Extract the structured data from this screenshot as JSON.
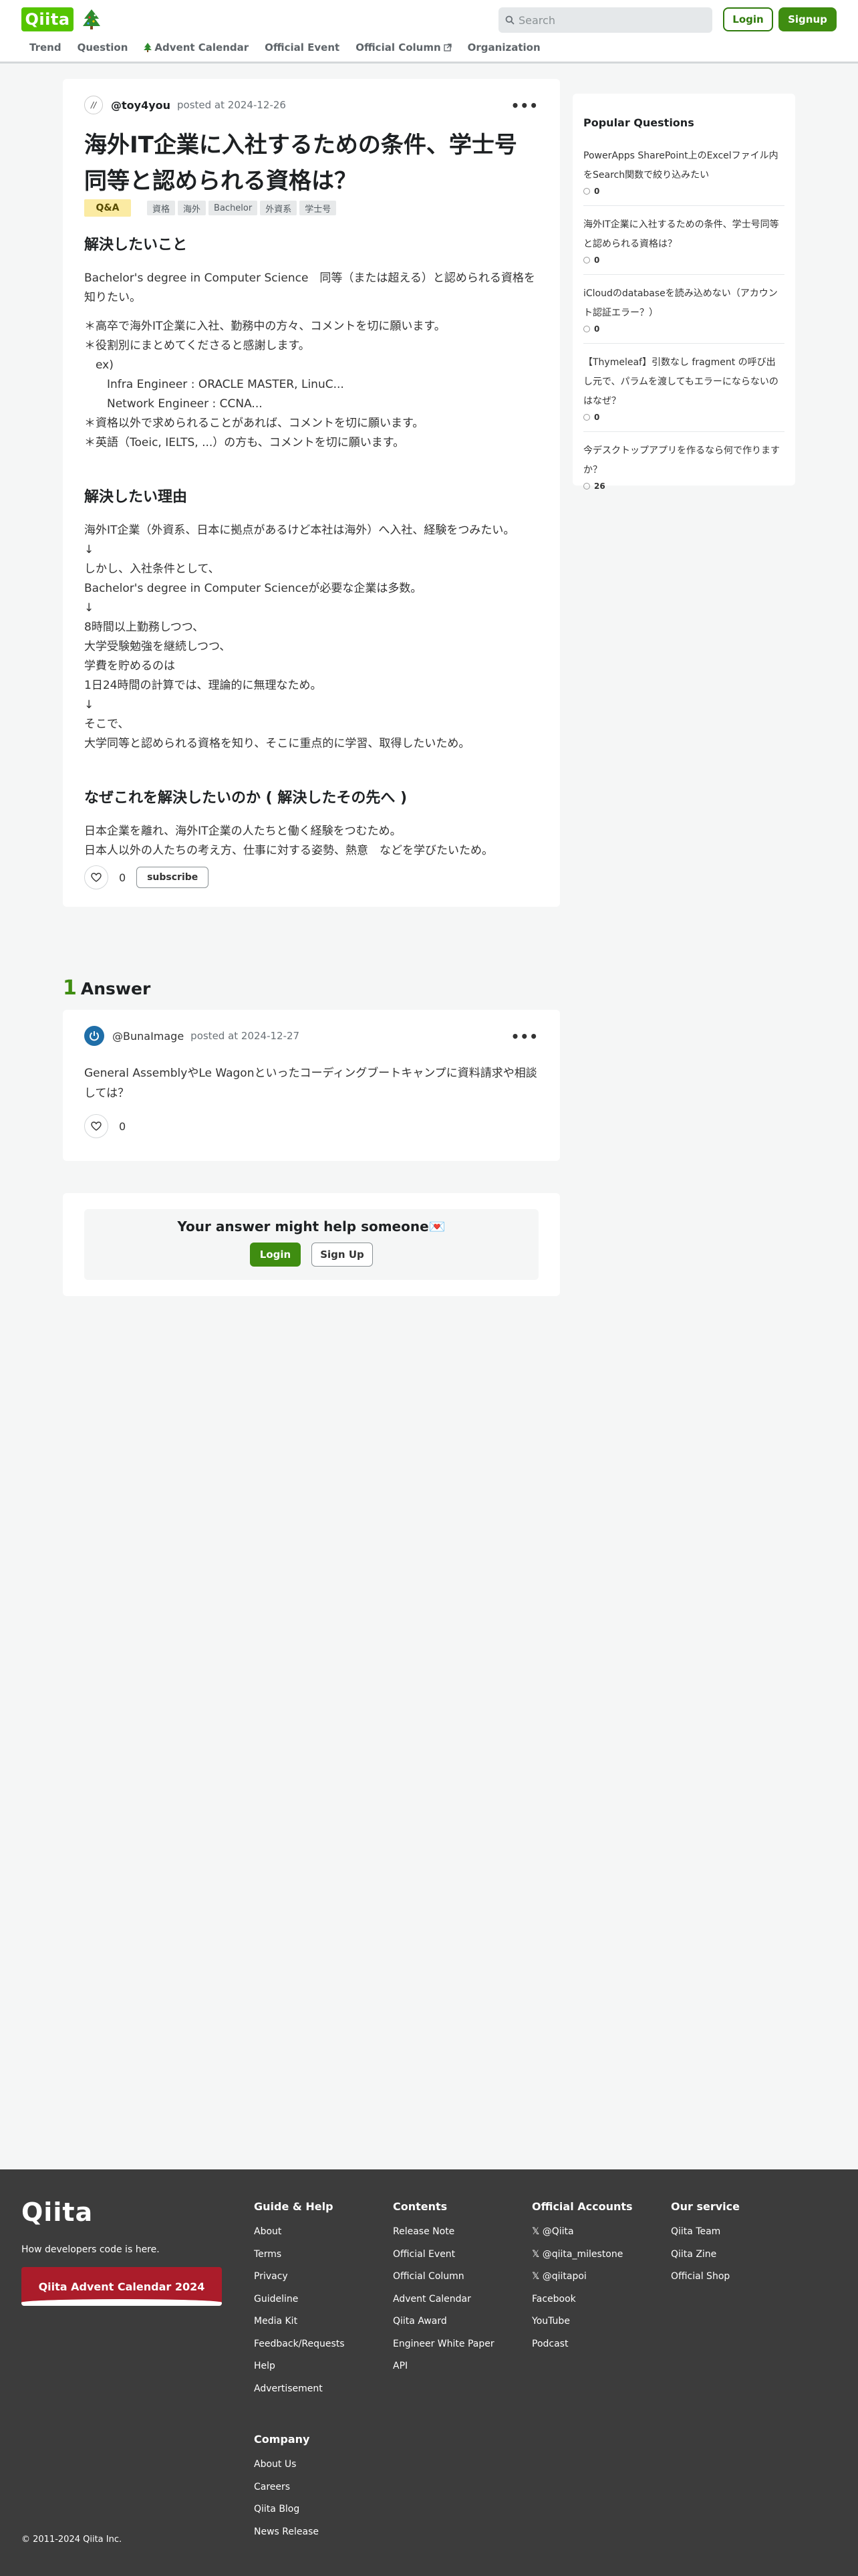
{
  "header": {
    "logo": "Qiita",
    "search_placeholder": "Search",
    "login_label": "Login",
    "signup_label": "Signup",
    "nav": [
      "Trend",
      "Question",
      "Advent Calendar",
      "Official Event",
      "Official Column",
      "Organization"
    ]
  },
  "question": {
    "author": "@toy4you",
    "posted": "posted at 2024-12-26",
    "title": "海外IT企業に入社するための条件、学士号同等と認められる資格は？",
    "badge": "Q&A",
    "tags": [
      "資格",
      "海外",
      "Bachelor",
      "外資系",
      "学士号"
    ],
    "sections": [
      {
        "heading": "解決したいこと",
        "paragraphs": [
          [
            "Bachelor's degree in Computer Science　同等（または超える）と認められる資格を知りたい。"
          ],
          [
            "＊高卒で海外IT企業に入社、勤務中の方々、コメントを切に願います。",
            "＊役割別にまとめてくださると感謝します。",
            "　ex)",
            "　　Infra Engineer : ORACLE MASTER, LinuC...",
            "　　Network Engineer : CCNA...",
            "＊資格以外で求められることがあれば、コメントを切に願います。",
            "＊英語（Toeic, IELTS, ...）の方も、コメントを切に願います。"
          ]
        ]
      },
      {
        "heading": "解決したい理由",
        "paragraphs": [
          [
            "海外IT企業（外資系、日本に拠点があるけど本社は海外）へ入社、経験をつみたい。",
            "↓",
            "しかし、入社条件として、",
            "Bachelor's degree in Computer Scienceが必要な企業は多数。",
            "↓",
            "8時間以上勤務しつつ、",
            "大学受験勉強を継続しつつ、",
            "学費を貯めるのは",
            "1日24時間の計算では、理論的に無理なため。",
            "↓",
            "そこで、",
            "大学同等と認められる資格を知り、そこに重点的に学習、取得したいため。"
          ]
        ]
      },
      {
        "heading": "なぜこれを解決したいのか ( 解決したその先へ )",
        "paragraphs": [
          [
            "日本企業を離れ、海外IT企業の人たちと働く経験をつむため。",
            "日本人以外の人たちの考え方、仕事に対する姿勢、熱意　などを学びたいため。"
          ]
        ]
      }
    ],
    "likes": "0",
    "subscribe_label": "subscribe"
  },
  "sidebar": {
    "title": "Popular Questions",
    "items": [
      {
        "question": "PowerApps SharePoint上のExcelファイル内をSearch関数で絞り込みたい",
        "comments": "0"
      },
      {
        "question": "海外IT企業に入社するための条件、学士号同等と認められる資格は？",
        "comments": "0"
      },
      {
        "question": "iCloudのdatabaseを読み込めない（アカウント認証エラー？）",
        "comments": "0"
      },
      {
        "question": "【Thymeleaf】引数なし fragment の呼び出し元で、パラムを渡してもエラーにならないのはなぜ？",
        "comments": "0"
      },
      {
        "question": "今デスクトップアプリを作るなら何で作りますか？",
        "comments": "26"
      }
    ]
  },
  "answers": {
    "count": "1",
    "label": "Answer",
    "items": [
      {
        "author": "@BunaImage",
        "posted": "posted at 2024-12-27",
        "body": "General AssemblyやLe Wagonといったコーディングブートキャンプに資料請求や相談しては？",
        "likes": "0"
      }
    ]
  },
  "cta": {
    "title": "Your answer might help someone💌",
    "login_label": "Login",
    "signup_label": "Sign Up"
  },
  "footer": {
    "logo": "Qiita",
    "tagline": "How developers code is here.",
    "banner": "Qiita Advent Calendar 2024",
    "columns": [
      {
        "title": "Guide & Help",
        "links": [
          "About",
          "Terms",
          "Privacy",
          "Guideline",
          "Media Kit",
          "Feedback/Requests",
          "Help",
          "Advertisement"
        ]
      },
      {
        "title": "Contents",
        "links": [
          "Release Note",
          "Official Event",
          "Official Column",
          "Advent Calendar",
          "Qiita Award",
          "Engineer White Paper",
          "API"
        ]
      },
      {
        "title": "Official Accounts",
        "links": [
          "@Qiita",
          "@qiita_milestone",
          "@qiitapoi",
          "Facebook",
          "YouTube",
          "Podcast"
        ]
      },
      {
        "title": "Our service",
        "links": [
          "Qiita Team",
          "Qiita Zine",
          "Official Shop"
        ]
      },
      {
        "title": "Company",
        "links": [
          "About Us",
          "Careers",
          "Qiita Blog",
          "News Release"
        ]
      }
    ],
    "copyright": "© 2011-2024 Qiita Inc."
  },
  "colors": {
    "brand": "#55c500",
    "accent_green": "#3f8d11",
    "footer_bg": "#3c3c3c",
    "badge_bg": "#fbeba3"
  }
}
